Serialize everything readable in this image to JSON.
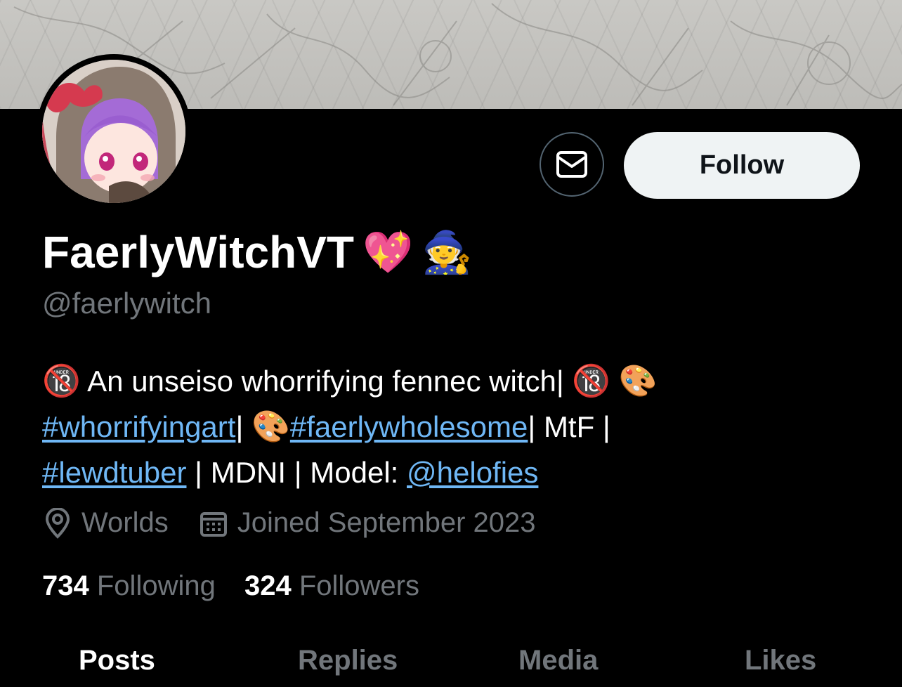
{
  "profile": {
    "display_name": "FaerlyWitchVT",
    "name_emojis": [
      "💖",
      "🧙"
    ],
    "handle": "@faerlywitch"
  },
  "actions": {
    "message_icon": "mail-icon",
    "follow_label": "Follow"
  },
  "bio": {
    "part1": " An unseiso whorrifying fennec witch| ",
    "tag1": "#whorrifyingart",
    "part2": "| ",
    "tag2": "#faerlywholesome",
    "part3": "| MtF |",
    "tag3": "#lewdtuber",
    "part4": " | MDNI | Model: ",
    "mention": "@helofies",
    "emoji_18": "🔞",
    "emoji_palette": "🎨"
  },
  "meta": {
    "location": "Worlds",
    "location_icon": "location-pin-icon",
    "joined": "Joined September 2023",
    "joined_icon": "calendar-icon"
  },
  "stats": {
    "following_count": "734",
    "following_label": "Following",
    "followers_count": "324",
    "followers_label": "Followers"
  },
  "tabs": [
    "Posts",
    "Replies",
    "Media",
    "Likes"
  ],
  "colors": {
    "background": "#000000",
    "link": "#6fb7f5",
    "muted": "#71767b",
    "follow_bg": "#eff3f4"
  }
}
